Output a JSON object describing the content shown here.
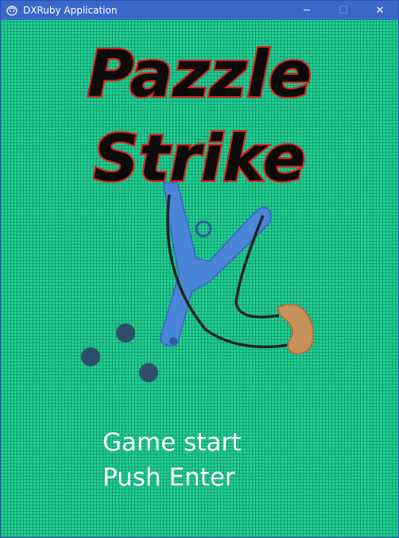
{
  "window": {
    "title": "DXRuby Application",
    "minimize_glyph": "─",
    "maximize_glyph": "☐",
    "close_glyph": "✕"
  },
  "game": {
    "logo_line1": "Pazzle",
    "logo_line2": "Strike",
    "menu_line1": "Game start",
    "menu_line2": "Push Enter"
  },
  "colors": {
    "background": "#1fcf93",
    "logo_fill": "#0a0a0a",
    "logo_outline": "#e0201a",
    "slingshot": "#4a86d8",
    "pouch": "#c8915a",
    "stones": "#2e4f6a"
  },
  "icons": [
    "app-icon",
    "minimize-icon",
    "maximize-icon",
    "close-icon"
  ]
}
